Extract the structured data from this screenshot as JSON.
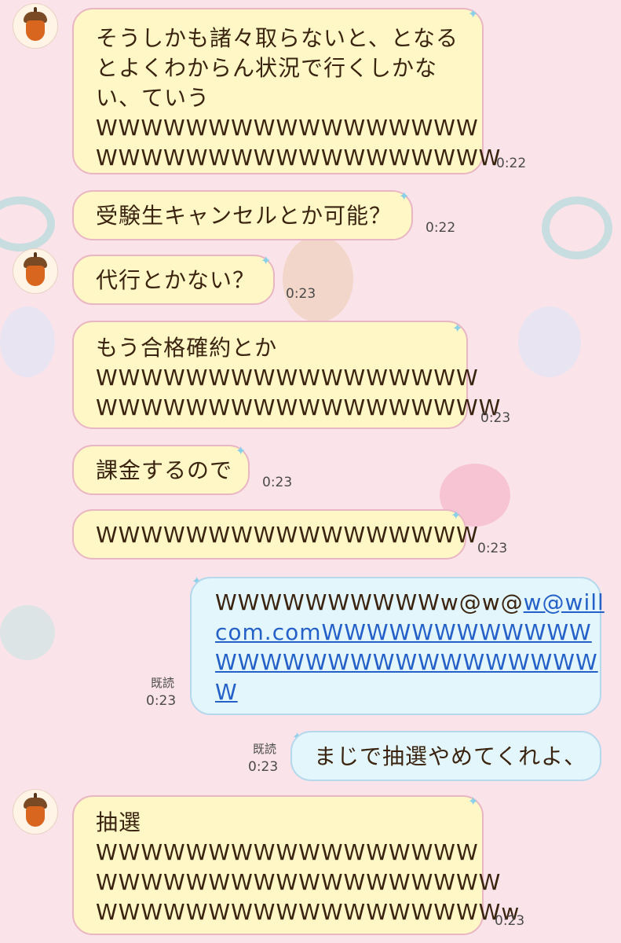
{
  "messages": [
    {
      "side": "in",
      "avatar": true,
      "lines": [
        "そうしかも諸々取らないと、となる",
        "とよくわからん状況で行くしかな",
        "い、ていう",
        "WWWWWWWWWWWWWWWWW",
        "WWWWWWWWWWWWWWWWWW"
      ],
      "time": "0:22"
    },
    {
      "side": "in",
      "avatar": false,
      "lines": [
        "受験生キャンセルとか可能？"
      ],
      "time": "0:22"
    },
    {
      "side": "in",
      "avatar": true,
      "lines": [
        "代行とかない？"
      ],
      "time": "0:23"
    },
    {
      "side": "in",
      "avatar": false,
      "lines": [
        "もう合格確約とか",
        "WWWWWWWWWWWWWWWWW",
        "WWWWWWWWWWWWWWWWWW"
      ],
      "time": "0:23"
    },
    {
      "side": "in",
      "avatar": false,
      "lines": [
        "課金するので"
      ],
      "time": "0:23"
    },
    {
      "side": "in",
      "avatar": false,
      "lines": [
        "WWWWWWWWWWWWWWWWW"
      ],
      "time": "0:23"
    },
    {
      "side": "out",
      "read_label": "既読",
      "time": "0:23",
      "text_before": "WWWWWWWWWWw@w@",
      "link_line1": "w@will",
      "link_line2": "com.com",
      "after_line2": "WWWWWWWWWWWW",
      "line3": "WWWWWWWWWWWWWWWWW",
      "line4": "W"
    },
    {
      "side": "out",
      "read_label": "既読",
      "time": "0:23",
      "lines": [
        "まじで抽選やめてくれよ、"
      ]
    },
    {
      "side": "in",
      "avatar": true,
      "lines": [
        "抽選",
        "WWWWWWWWWWWWWWWWW",
        "WWWWWWWWWWWWWWWWWW",
        "WWWWWWWWWWWWWWWWWWw"
      ],
      "time": "0:23"
    }
  ],
  "icons": {
    "avatar": "acorn-icon",
    "sparkle": "sparkle-icon"
  },
  "colors": {
    "background": "#fbe3ea",
    "incoming_bubble": "#fff7c6",
    "outgoing_bubble": "#e2f6fb",
    "link": "#2460c8"
  }
}
